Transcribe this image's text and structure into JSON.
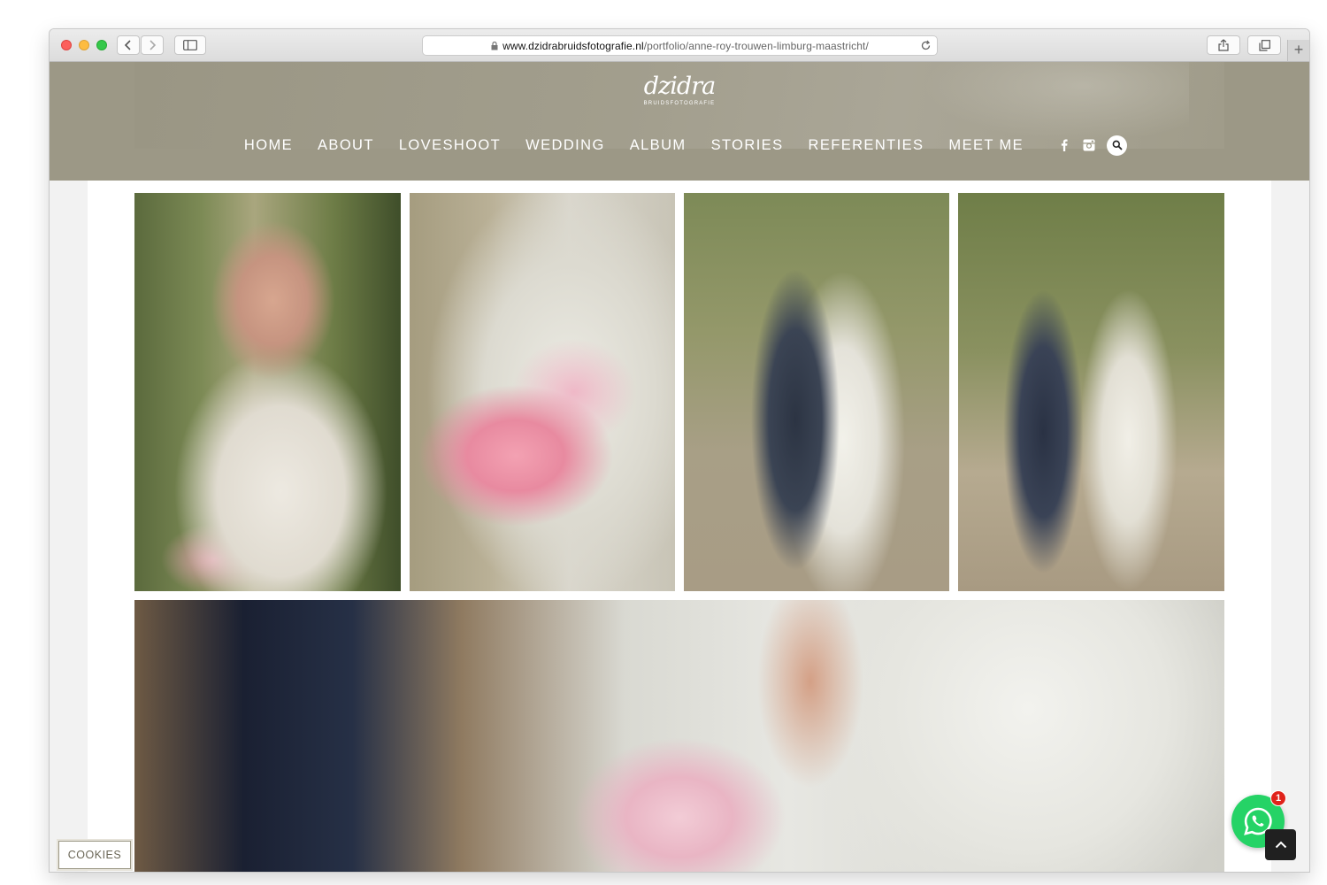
{
  "browser": {
    "url_domain": "www.dzidrabruidsfotografie.nl",
    "url_path": "/portfolio/anne-roy-trouwen-limburg-maastricht/",
    "new_tab_label": "+"
  },
  "site": {
    "logo_word": "dzidra",
    "logo_sub": "BRUIDSFOTOGRAFIE",
    "nav": [
      {
        "label": "HOME"
      },
      {
        "label": "ABOUT"
      },
      {
        "label": "LOVESHOOT"
      },
      {
        "label": "WEDDING"
      },
      {
        "label": "ALBUM"
      },
      {
        "label": "STORIES"
      },
      {
        "label": "REFERENTIES"
      },
      {
        "label": "MEET ME"
      }
    ],
    "social_icons": [
      "facebook-icon",
      "instagram-icon",
      "search-icon"
    ],
    "accent_color": "#9c9886"
  },
  "gallery": {
    "photos": [
      {
        "icon": "photo-bride-portrait"
      },
      {
        "icon": "photo-bouquet-dress"
      },
      {
        "icon": "photo-couple-standing"
      },
      {
        "icon": "photo-couple-walking"
      },
      {
        "icon": "photo-bouquet-lace-closeup"
      }
    ]
  },
  "widgets": {
    "cookies_label": "COOKIES",
    "whatsapp_badge": "1",
    "whatsapp_color": "#25d366"
  }
}
